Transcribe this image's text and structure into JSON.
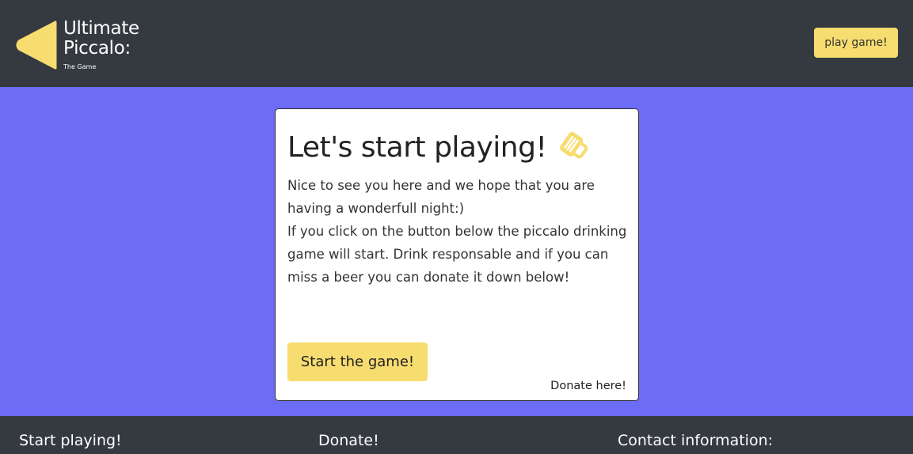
{
  "header": {
    "logo_title": "Ultimate\nPiccalo:",
    "logo_subtitle": "The Game",
    "play_button": "play game!"
  },
  "card": {
    "title": "Let's start playing!",
    "icon": "beer-mug-icon",
    "paragraph_1": "Nice to see you here and we hope that you are having a wonderfull night:)",
    "paragraph_2": "If you click on the button below the piccalo drinking game will start. Drink responsable and if you can miss a beer you can donate it down below!",
    "start_button": "Start the game!",
    "donate_link": "Donate here!"
  },
  "footer": {
    "col_1": "Start playing!",
    "col_2": "Donate!",
    "col_3": "Contact information:"
  },
  "colors": {
    "header_bg": "#343a40",
    "page_bg": "#6c6cf7",
    "accent_yellow": "#f7dc6f",
    "card_bg": "#ffffff"
  }
}
